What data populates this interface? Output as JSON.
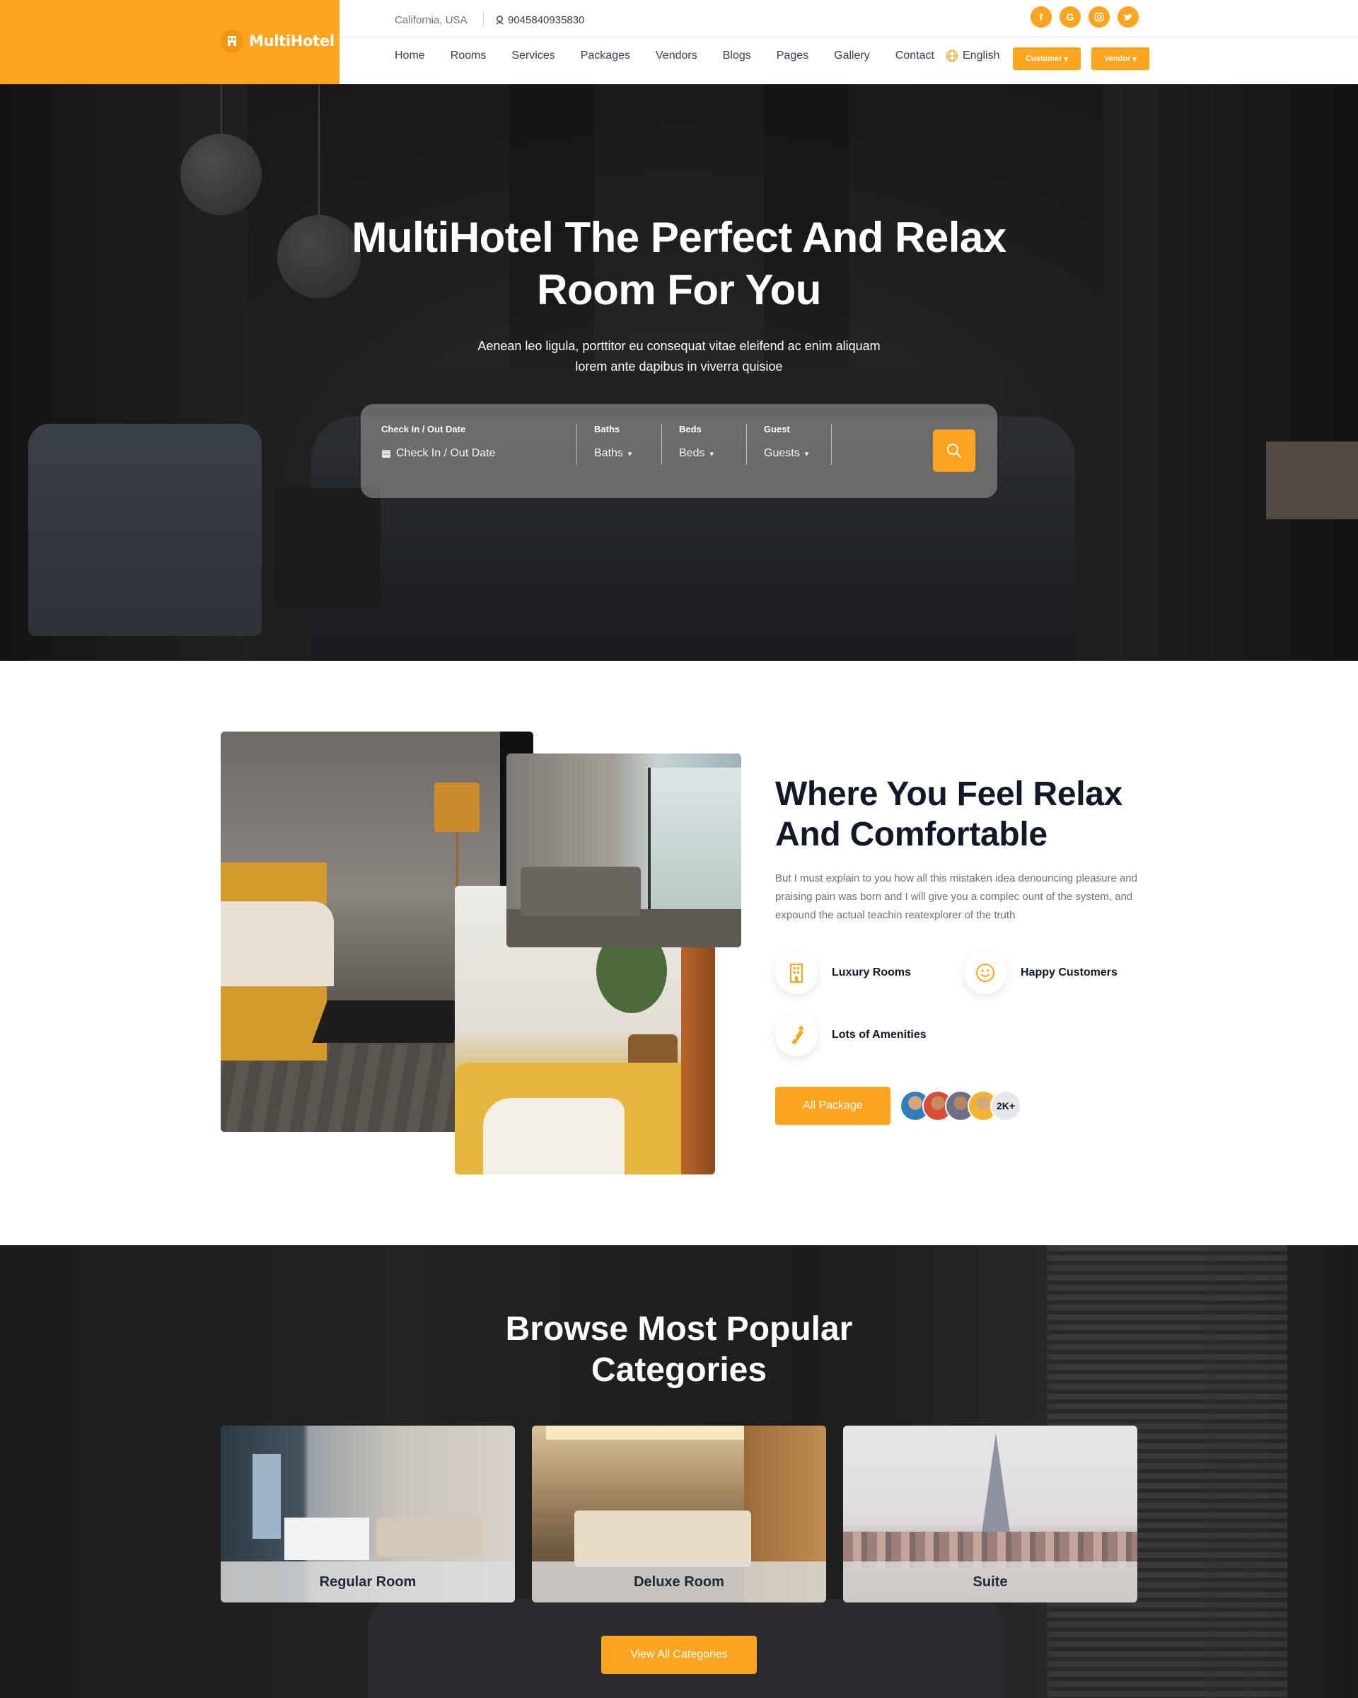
{
  "brand": {
    "name": "MultiHotel",
    "accent": "#fda51e"
  },
  "topbar": {
    "location": "California, USA",
    "phone": "9045840935830",
    "socials": [
      {
        "name": "facebook",
        "glyph": "f"
      },
      {
        "name": "google",
        "glyph": "G"
      },
      {
        "name": "instagram",
        "glyph": "◎"
      },
      {
        "name": "twitter",
        "glyph": "🐦"
      }
    ]
  },
  "nav": {
    "items": [
      "Home",
      "Rooms",
      "Services",
      "Packages",
      "Vendors",
      "Blogs",
      "Pages",
      "Gallery",
      "Contact"
    ],
    "language": "English",
    "customer_btn": "Customer",
    "vendor_btn": "Vendor"
  },
  "hero": {
    "title": "MultiHotel The Perfect And Relax Room For You",
    "subtitle": "Aenean leo ligula, porttitor eu consequat vitae eleifend ac enim aliquam lorem ante dapibus in viverra quisioe",
    "search": {
      "date_label": "Check In / Out Date",
      "date_placeholder": "Check In / Out Date",
      "baths_label": "Baths",
      "baths_value": "Baths",
      "beds_label": "Beds",
      "beds_value": "Beds",
      "guest_label": "Guest",
      "guest_value": "Guests"
    }
  },
  "about": {
    "title": "Where You Feel Relax And Comfortable",
    "text": "But I must explain to you how all this mistaken idea denouncing pleasure and praising pain was born and I will give you a complec ount of the system, and expound the actual teachin reatexplorer of the truth",
    "features": [
      "Luxury Rooms",
      "Happy Customers",
      "Lots of Amenities"
    ],
    "button": "All Package",
    "customers_count": "2K+"
  },
  "categories": {
    "title": "Browse Most Popular Categories",
    "items": [
      "Regular Room",
      "Deluxe Room",
      "Suite"
    ],
    "button": "View All Categories"
  }
}
